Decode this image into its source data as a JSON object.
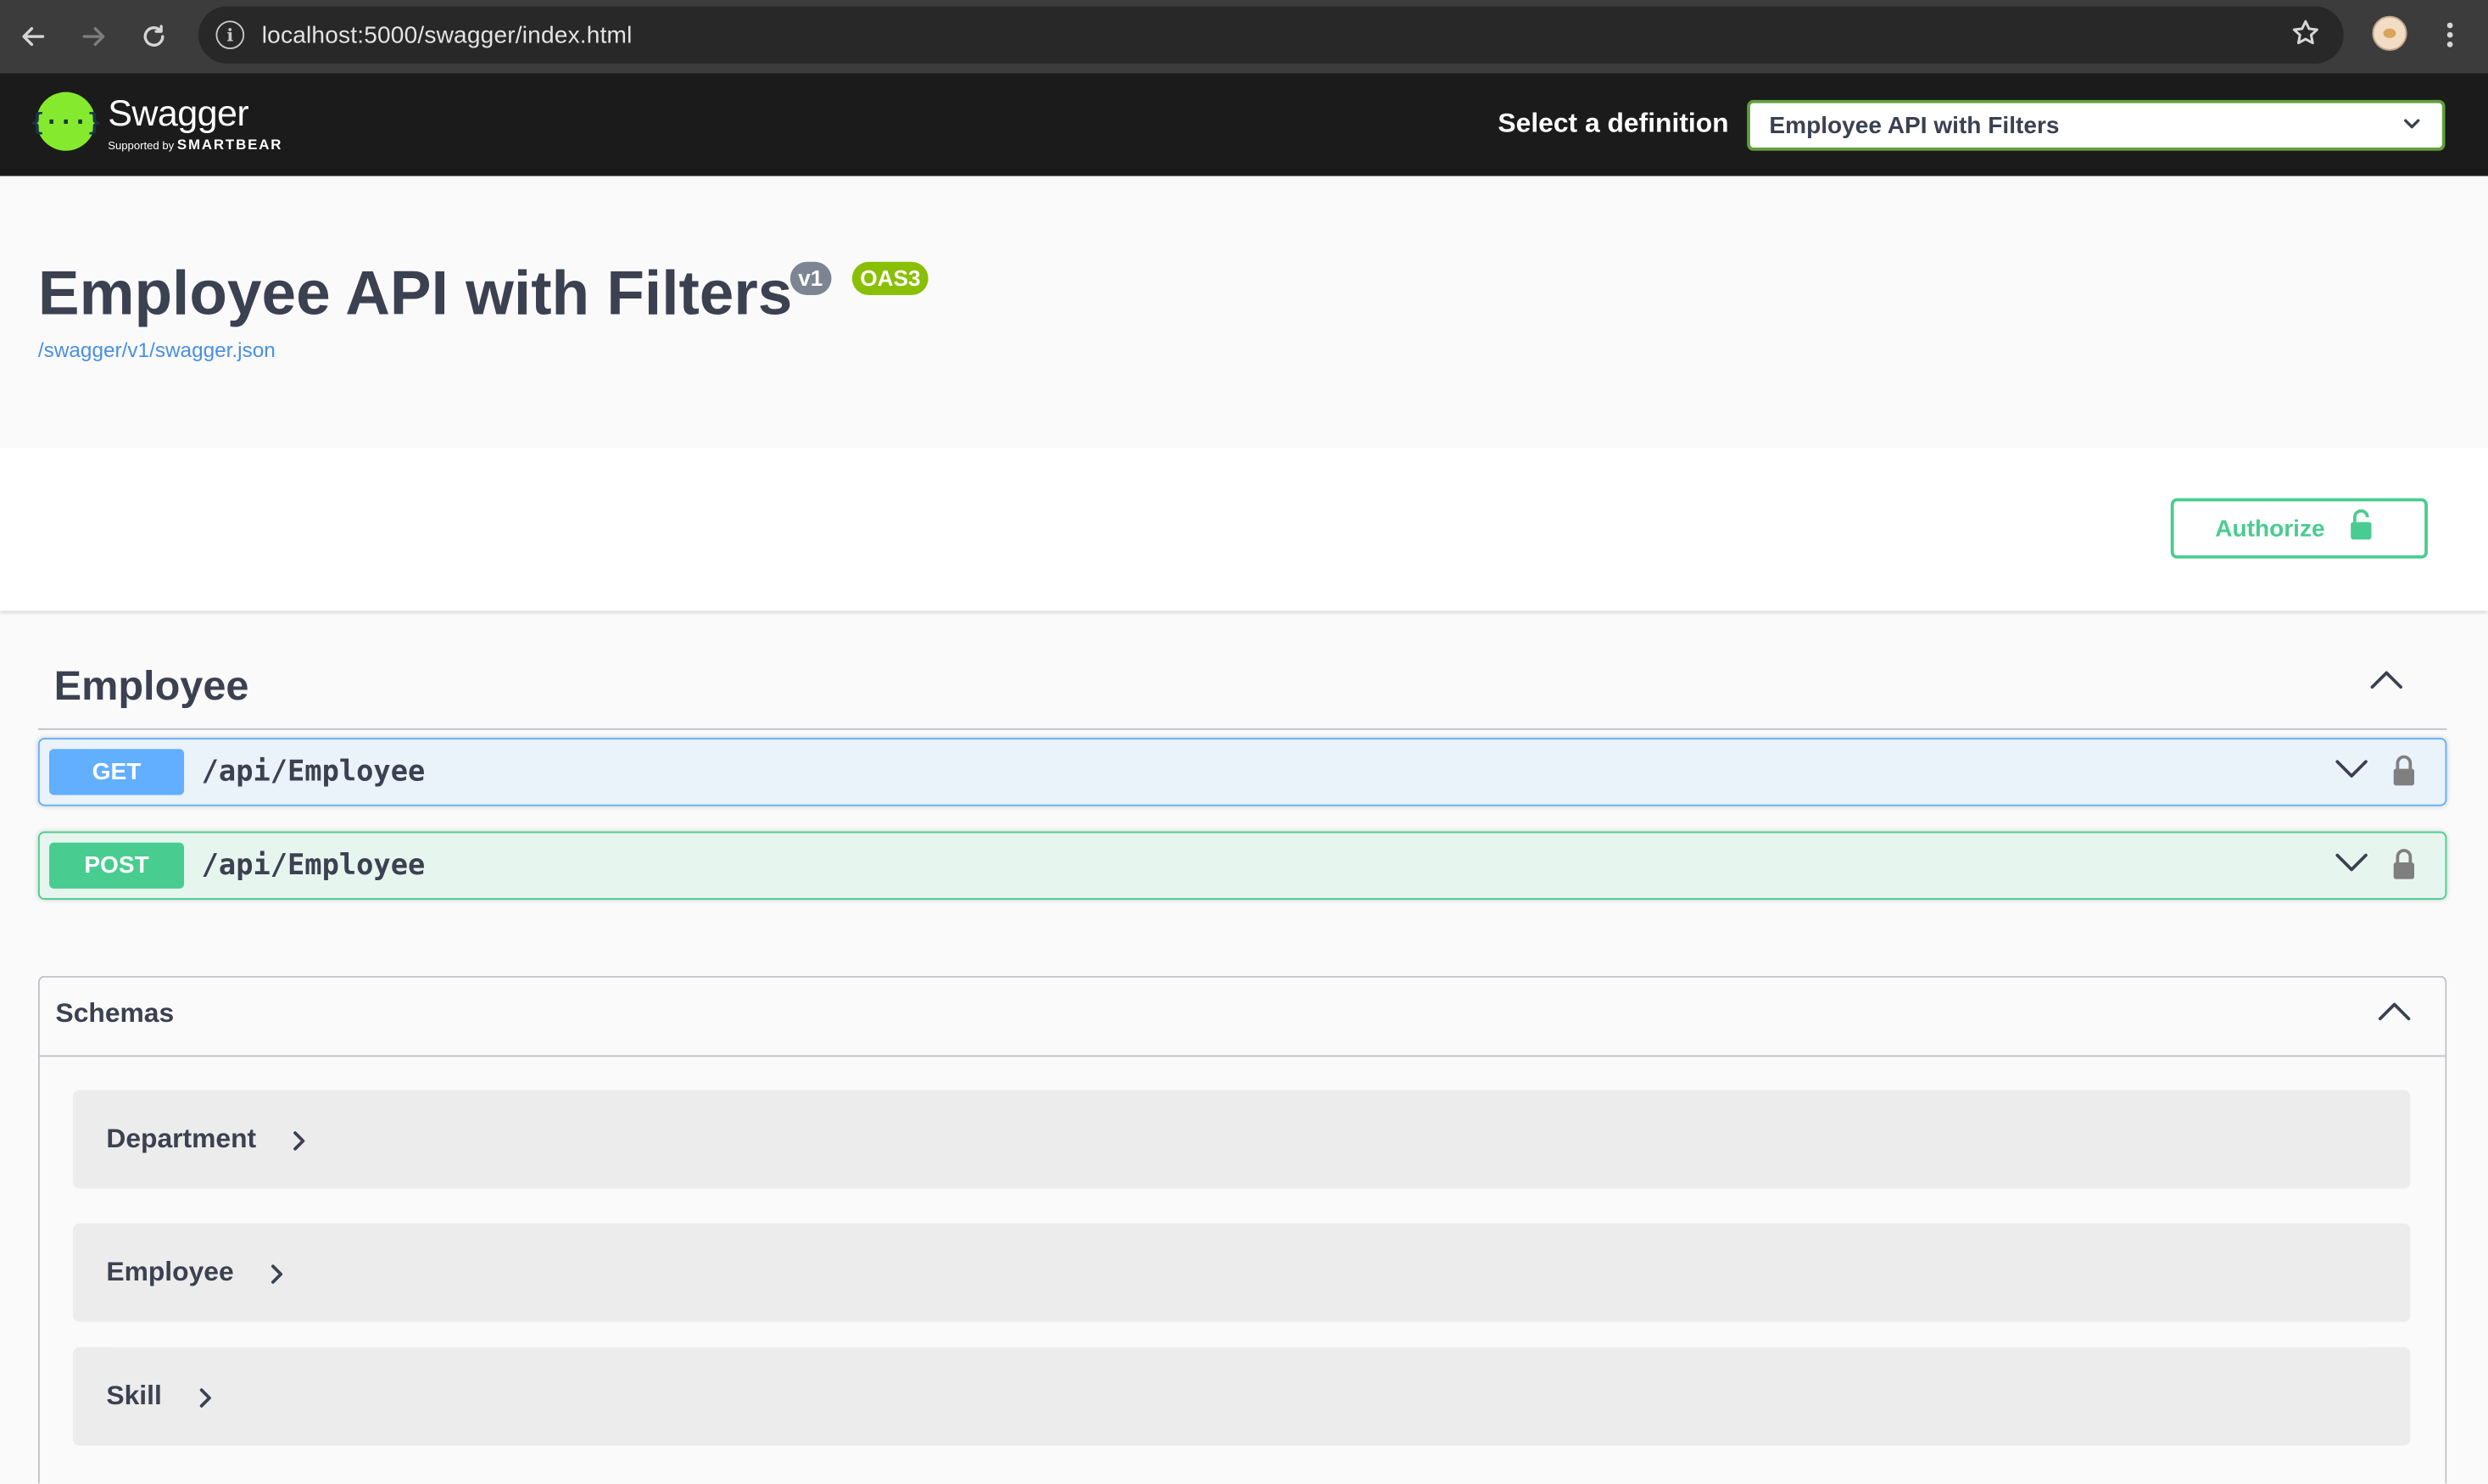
{
  "browser": {
    "url": "localhost:5000/swagger/index.html"
  },
  "topbar": {
    "logo_name": "Swagger",
    "logo_sub_prefix": "Supported by",
    "logo_sub_brand": "SMARTBEAR",
    "select_label": "Select a definition",
    "selected_definition": "Employee API with Filters"
  },
  "info": {
    "title": "Employee API with Filters",
    "version_badge": "v1",
    "oas_badge": "OAS3",
    "spec_url": "/swagger/v1/swagger.json"
  },
  "authorize": {
    "label": "Authorize"
  },
  "tag": {
    "name": "Employee",
    "operations": [
      {
        "method": "GET",
        "path": "/api/Employee"
      },
      {
        "method": "POST",
        "path": "/api/Employee"
      }
    ]
  },
  "schemas": {
    "title": "Schemas",
    "items": [
      "Department",
      "Employee",
      "Skill"
    ]
  },
  "colors": {
    "get": "#61affe",
    "post": "#49cc90",
    "topbar_bg": "#1b1b1b",
    "logo": "#85ea2d",
    "select_border": "#62a03f",
    "link": "#4990e2",
    "oas_badge": "#89bf04",
    "version_badge": "#7d8492"
  },
  "icons": {
    "back": "arrow-left-icon",
    "forward": "arrow-right-icon",
    "reload": "reload-icon",
    "site_info": "info-icon",
    "bookmark": "star-icon",
    "menu": "kebab-menu-icon",
    "lock": "lock-icon",
    "expand": "chevron-down-icon",
    "collapse": "chevron-up-icon",
    "model_expand": "chevron-right-icon"
  }
}
